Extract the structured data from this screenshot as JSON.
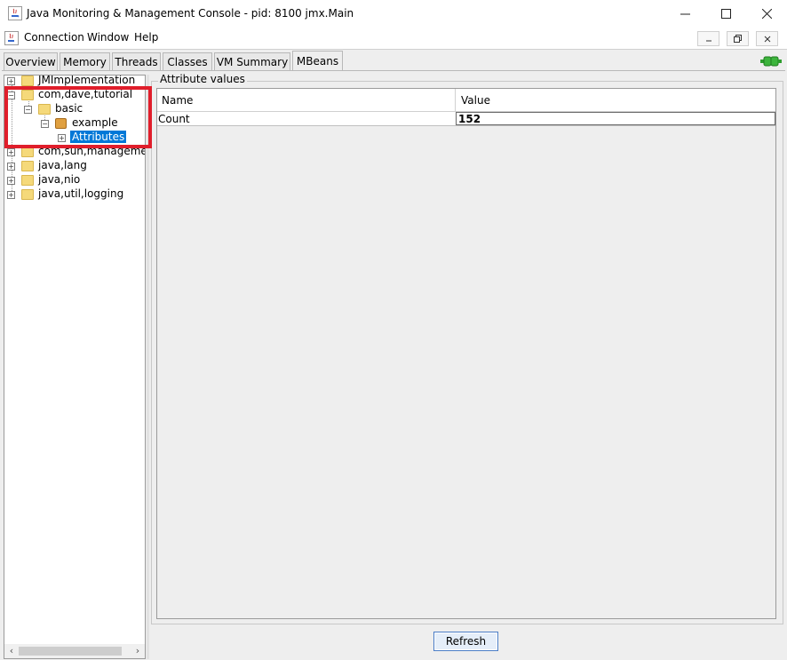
{
  "window": {
    "title": "Java Monitoring & Management Console - pid: 8100 jmx.Main",
    "controls": {
      "minimize": "—",
      "maximize": "☐",
      "close": "✕"
    }
  },
  "menubar": {
    "items": [
      "Connection",
      "Window",
      "Help"
    ],
    "inner_controls": {
      "minimize": "_",
      "restore": "⧉",
      "close": "✕"
    }
  },
  "tabs": [
    {
      "label": "Overview",
      "active": false
    },
    {
      "label": "Memory",
      "active": false
    },
    {
      "label": "Threads",
      "active": false
    },
    {
      "label": "Classes",
      "active": false
    },
    {
      "label": "VM Summary",
      "active": false
    },
    {
      "label": "MBeans",
      "active": true
    }
  ],
  "tree": {
    "nodes": [
      {
        "label": "JMImplementation",
        "level": 0,
        "expanded": false,
        "icon": "folder-icon"
      },
      {
        "label": "com,dave,tutorial",
        "level": 0,
        "expanded": true,
        "icon": "folder-icon"
      },
      {
        "label": "basic",
        "level": 1,
        "expanded": true,
        "icon": "folder-icon"
      },
      {
        "label": "example",
        "level": 2,
        "expanded": true,
        "icon": "mbean-icon"
      },
      {
        "label": "Attributes",
        "level": 3,
        "expanded": false,
        "icon": "none",
        "selected": true
      },
      {
        "label": "com,sun,manageme",
        "level": 0,
        "expanded": false,
        "icon": "folder-icon"
      },
      {
        "label": "java,lang",
        "level": 0,
        "expanded": false,
        "icon": "folder-icon"
      },
      {
        "label": "java,nio",
        "level": 0,
        "expanded": false,
        "icon": "folder-icon"
      },
      {
        "label": "java,util,logging",
        "level": 0,
        "expanded": false,
        "icon": "folder-icon"
      }
    ],
    "scroll_left": "‹",
    "scroll_right": "›"
  },
  "attributes": {
    "group_title": "Attribute values",
    "columns": [
      "Name",
      "Value"
    ],
    "rows": [
      {
        "name": "Count",
        "value": "152"
      }
    ]
  },
  "refresh_button": {
    "label": "Refresh"
  },
  "colors": {
    "highlight": "#e01e2b",
    "selection": "#0078d7",
    "connected": "#2e9e2e"
  }
}
